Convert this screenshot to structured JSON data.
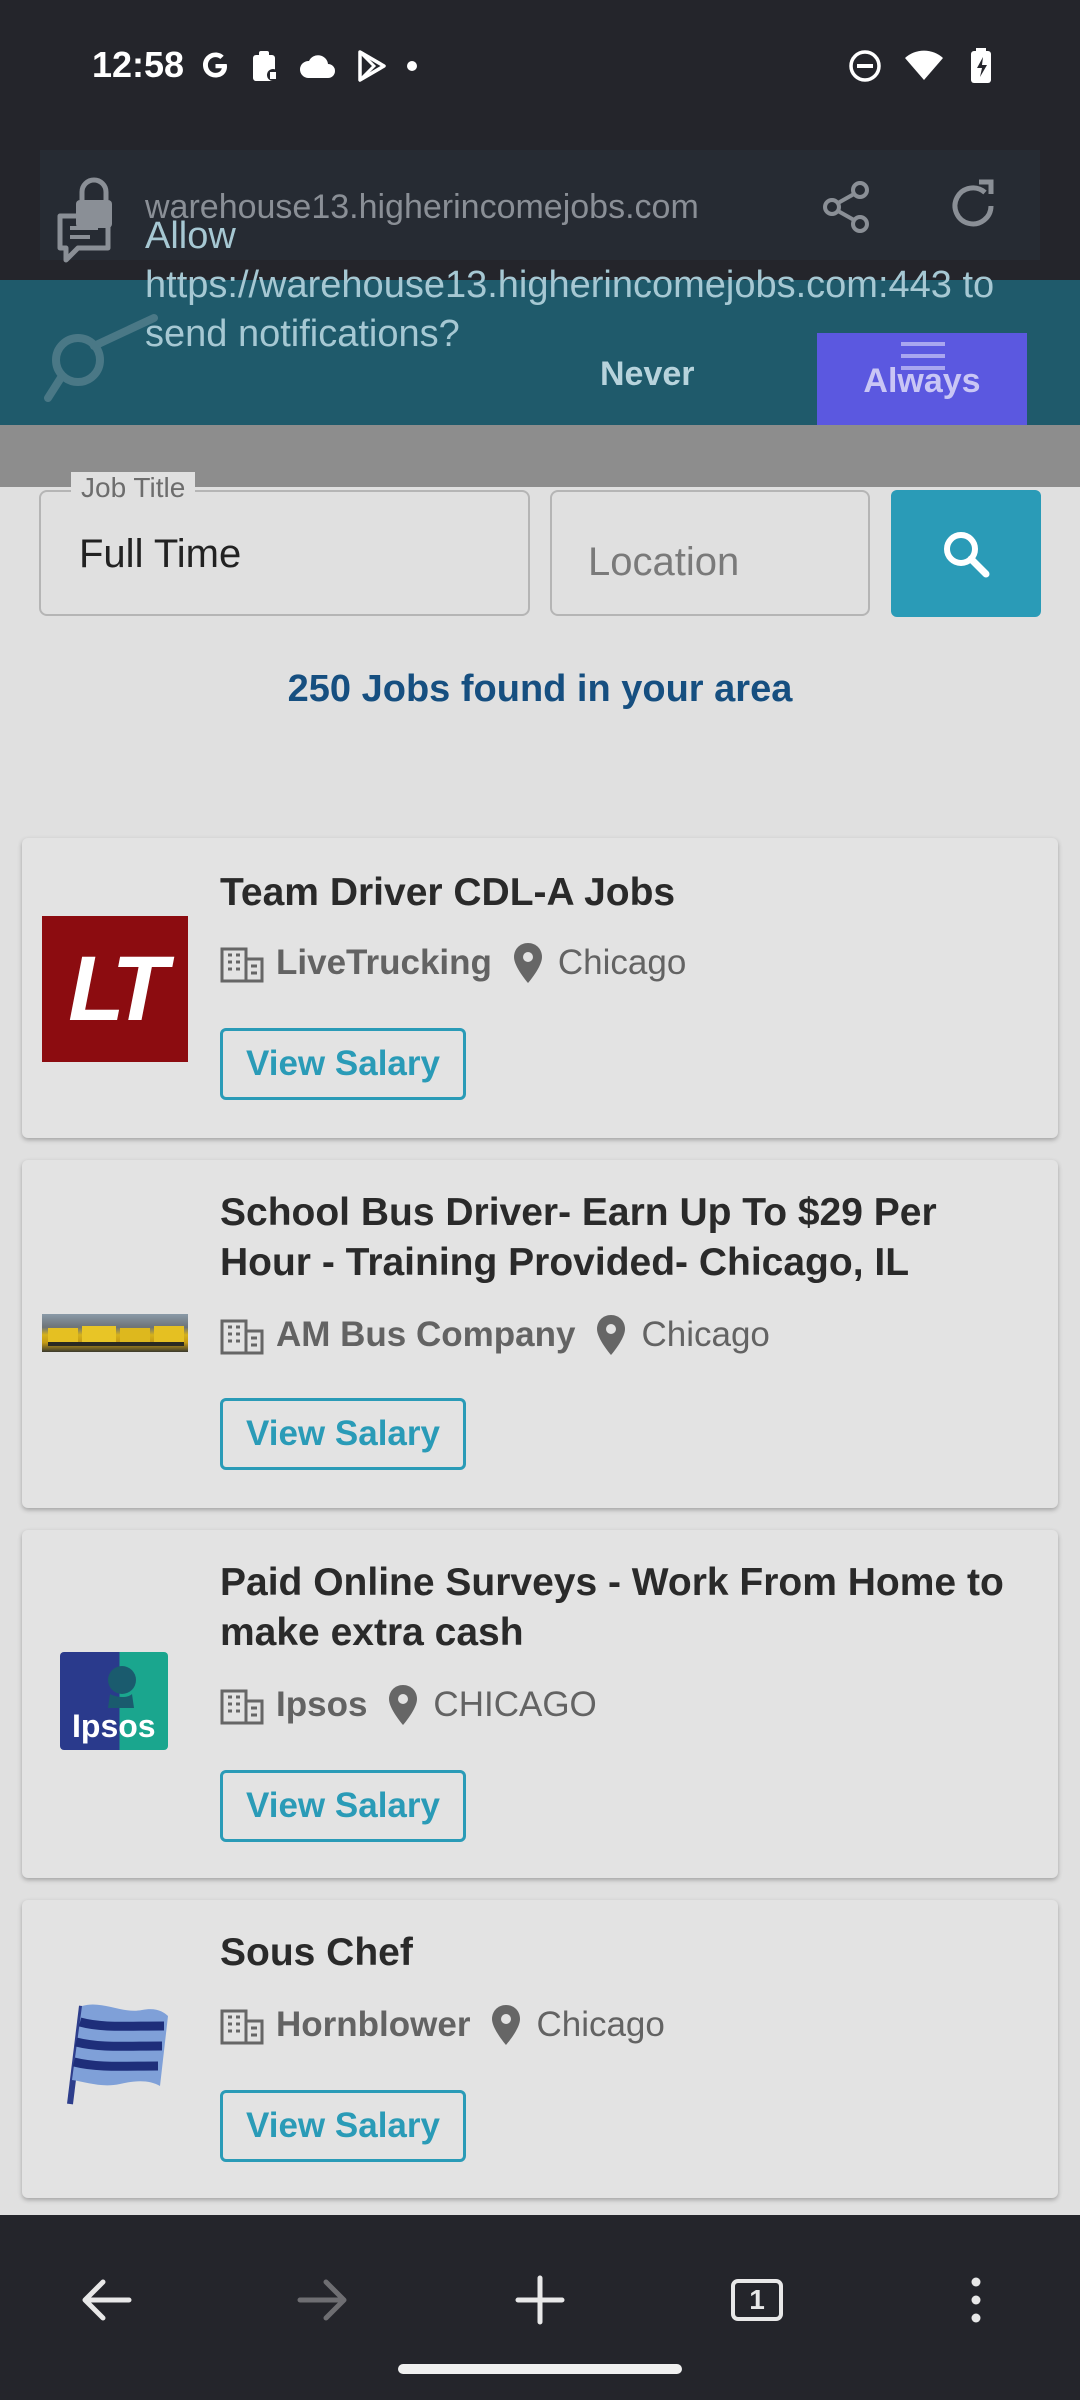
{
  "status_bar": {
    "time": "12:58",
    "left_icons": [
      "google-icon",
      "clipboard-icon",
      "cloud-icon",
      "play-store-icon",
      "dot-icon"
    ],
    "right_icons": [
      "dnd-icon",
      "wifi-icon",
      "battery-icon"
    ]
  },
  "browser": {
    "url": "warehouse13.higherincomejobs.com",
    "icons": [
      "lock-icon",
      "share-icon",
      "reload-icon"
    ]
  },
  "notification_prompt": {
    "message": "Allow https://warehouse13.higherincomejobs.com:443 to send notifications?",
    "never_label": "Never",
    "always_label": "Always"
  },
  "search": {
    "job_title_label": "Job Title",
    "job_title_value": "Full Time",
    "location_placeholder": "Location"
  },
  "results_summary": "250 Jobs found in your area",
  "jobs": [
    {
      "title": "Team Driver CDL-A Jobs",
      "company": "LiveTrucking",
      "city": "Chicago",
      "button": "View Salary",
      "logo_text": "LT"
    },
    {
      "title": "School Bus Driver- Earn Up To $29 Per Hour - Training Provided- Chicago, IL",
      "company": "AM Bus Company",
      "city": "Chicago",
      "button": "View Salary"
    },
    {
      "title": "Paid Online Surveys - Work From Home to make extra cash",
      "company": "Ipsos",
      "city": "CHICAGO",
      "button": "View Salary",
      "logo_text": "Ipsos"
    },
    {
      "title": "Sous Chef",
      "company": "Hornblower",
      "city": "Chicago",
      "button": "View Salary"
    }
  ],
  "nav": {
    "icons": [
      "back-icon",
      "forward-icon",
      "new-tab-icon",
      "tab-switcher-icon",
      "more-icon"
    ],
    "tab_count": "1"
  },
  "colors": {
    "accent": "#2a9bb7",
    "summary_text": "#164f80",
    "always_button": "#5b58e0",
    "notification_bg": "#1f5a6b",
    "system_bar": "#24252b"
  }
}
